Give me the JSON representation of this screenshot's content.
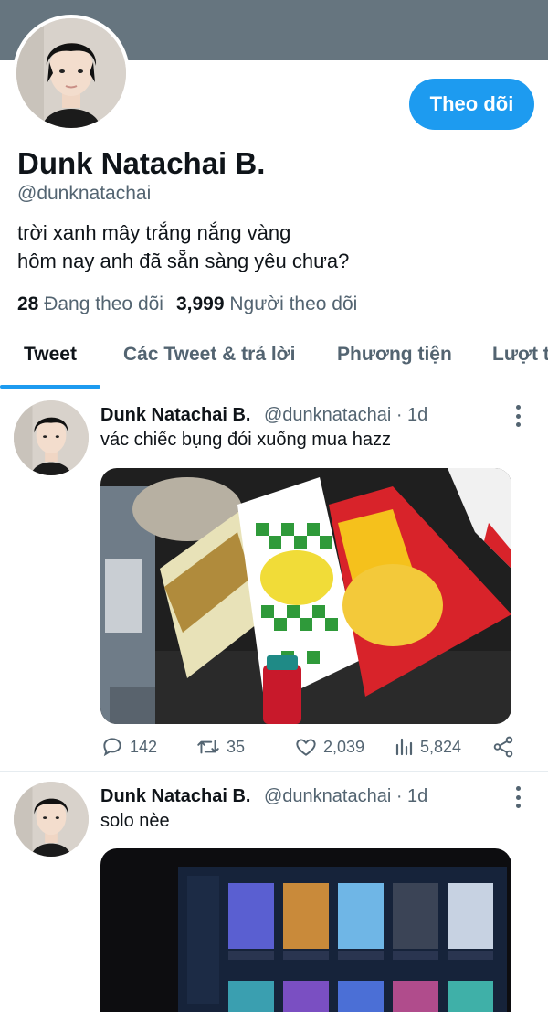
{
  "profile": {
    "name": "Dunk Natachai B.",
    "handle": "@dunknatachai",
    "bio_line1": "trời xanh mây trắng nắng vàng",
    "bio_line2": "hôm nay anh đã sẵn sàng yêu chưa?",
    "following_count": "28",
    "following_label": "Đang theo dõi",
    "followers_count": "3,999",
    "followers_label": "Người theo dõi",
    "follow_button": "Theo dõi",
    "banner_color": "#66757f"
  },
  "tabs": [
    {
      "label": "Tweet",
      "active": true
    },
    {
      "label": "Các Tweet & trả lời",
      "active": false
    },
    {
      "label": "Phương tiện",
      "active": false
    },
    {
      "label": "Lượt thích",
      "active": false
    }
  ],
  "tweets": [
    {
      "name": "Dunk Natachai B.",
      "meta": "@dunknatachai · 1d",
      "text": "vác chiếc bụng đói xuống mua hazz",
      "replies": "142",
      "retweets": "35",
      "likes": "2,039",
      "views": "5,824"
    },
    {
      "name": "Dunk Natachai B.",
      "meta": "@dunknatachai · 1d",
      "text": "solo nèe"
    }
  ],
  "colors": {
    "accent": "#1d9bf0",
    "muted_text": "#536471",
    "primary_text": "#0f1419"
  },
  "icons": [
    "more-vertical-icon",
    "reply-icon",
    "retweet-icon",
    "like-icon",
    "views-icon",
    "share-icon"
  ]
}
